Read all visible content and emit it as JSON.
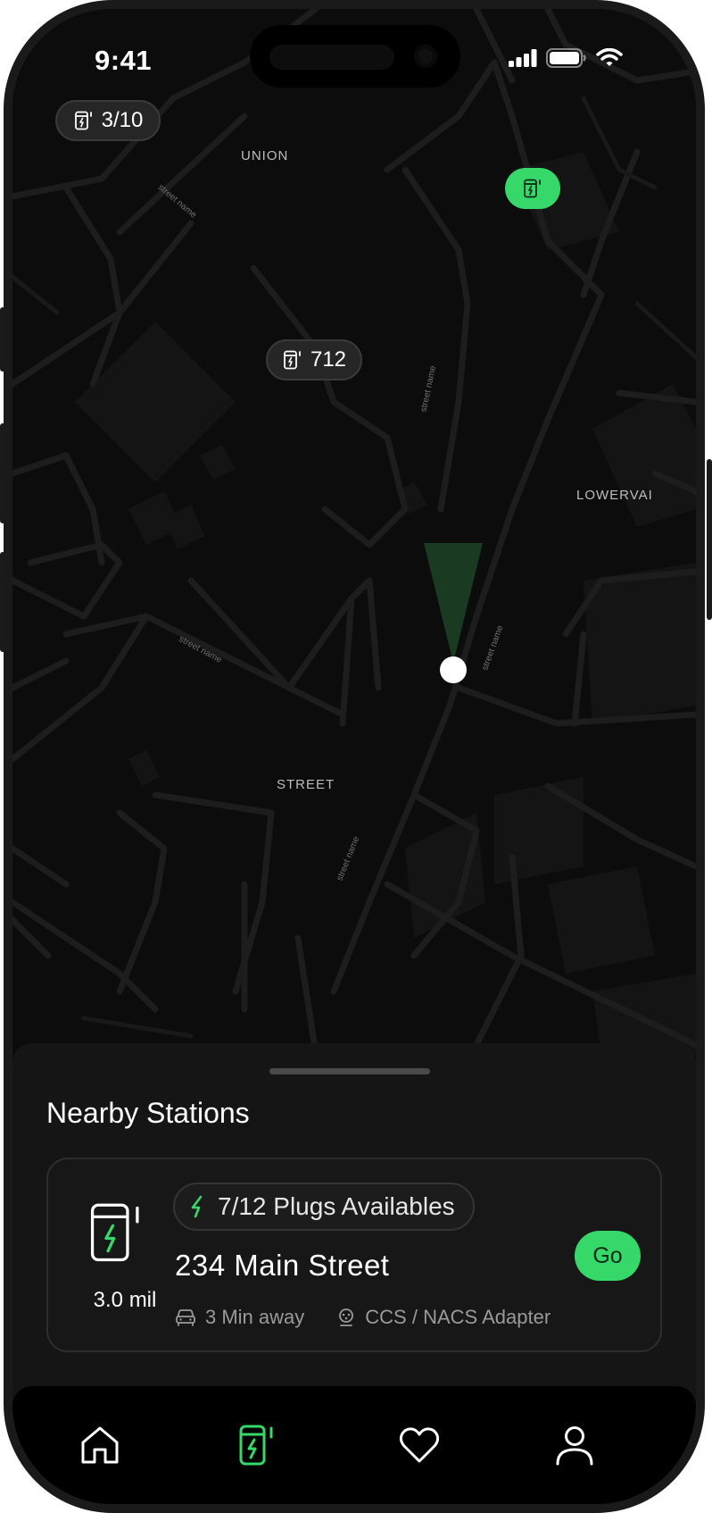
{
  "status_bar": {
    "time": "9:41"
  },
  "map": {
    "area_labels": [
      "UNION",
      "LOWERVAI",
      "STREET"
    ],
    "street_labels": [
      "street name",
      "street name",
      "street name",
      "street name",
      "street name"
    ],
    "pill_counter": "3/10",
    "pill_station": "712",
    "accent_color": "#36d86a"
  },
  "sheet": {
    "title": "Nearby Stations",
    "station": {
      "distance": "3.0 mil",
      "plugs": "7/12 Plugs Availables",
      "address": "234 Main Street",
      "eta": "3 Min away",
      "connector": "CCS / NACS Adapter",
      "go_label": "Go"
    }
  },
  "tabbar": {
    "items": [
      {
        "icon": "home-icon",
        "active": false
      },
      {
        "icon": "charging-station-icon",
        "active": true
      },
      {
        "icon": "heart-icon",
        "active": false
      },
      {
        "icon": "profile-icon",
        "active": false
      }
    ]
  }
}
